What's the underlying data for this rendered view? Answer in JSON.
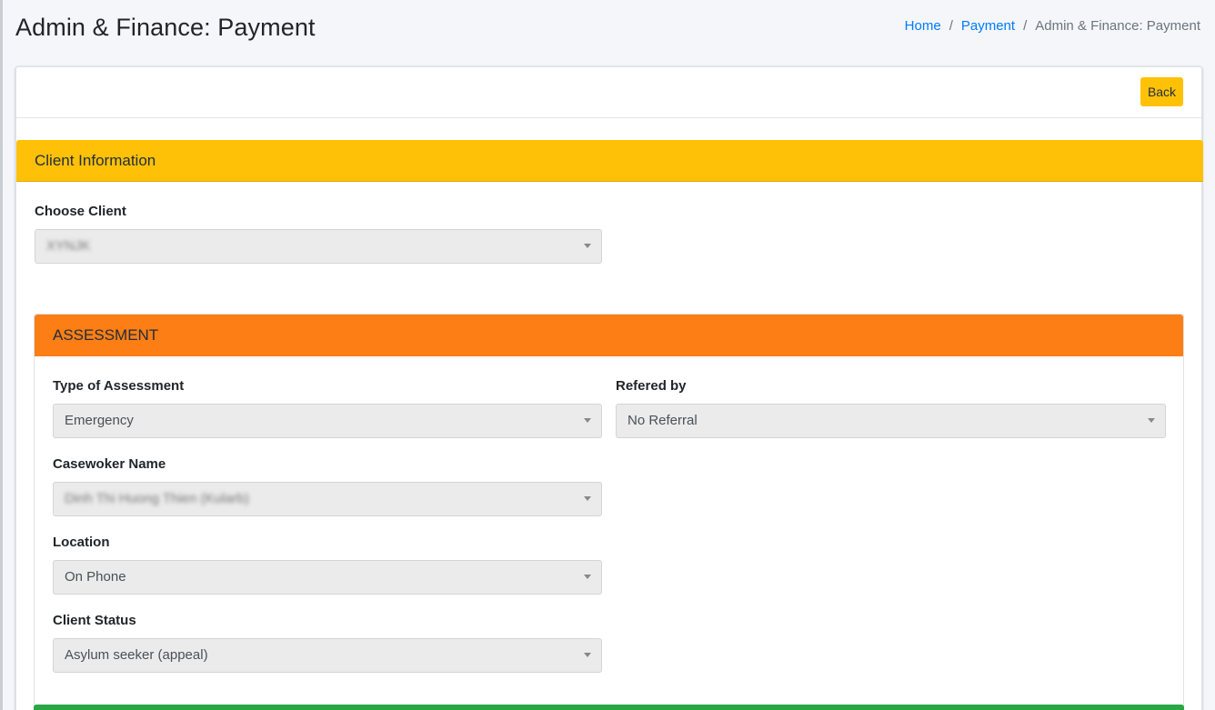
{
  "page": {
    "title": "Admin & Finance: Payment"
  },
  "breadcrumb": {
    "home": "Home",
    "payment": "Payment",
    "current": "Admin & Finance: Payment",
    "separator": "/"
  },
  "toolbar": {
    "back_label": "Back"
  },
  "client_info": {
    "header": "Client Information",
    "choose_client_label": "Choose Client",
    "choose_client_value": "XYNJK"
  },
  "assessment": {
    "header": "ASSESSMENT",
    "type_label": "Type of Assessment",
    "type_value": "Emergency",
    "referred_label": "Refered by",
    "referred_value": "No Referral",
    "caseworker_label": "Casewoker Name",
    "caseworker_value": "Dinh Thi Huong Thien (Kularb)",
    "location_label": "Location",
    "location_value": "On Phone",
    "status_label": "Client Status",
    "status_value": "Asylum seeker (appeal)"
  },
  "colors": {
    "warning": "#ffc107",
    "orange": "#fd7e14",
    "success": "#28a745",
    "link": "#007bff"
  }
}
